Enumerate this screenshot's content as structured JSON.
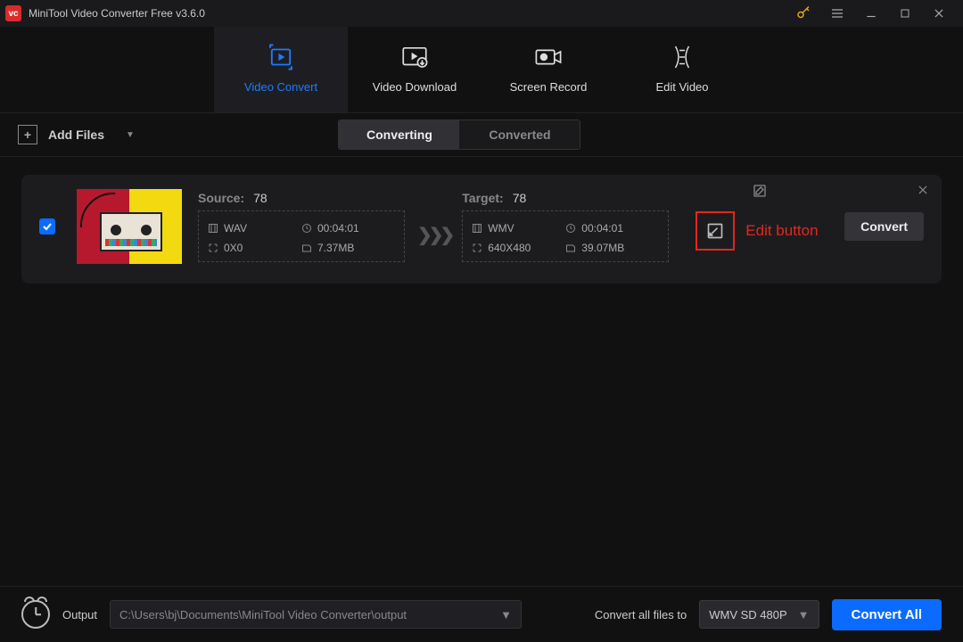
{
  "title": "MiniTool Video Converter Free v3.6.0",
  "nav": {
    "convert": "Video Convert",
    "download": "Video Download",
    "record": "Screen Record",
    "edit": "Edit Video"
  },
  "actionbar": {
    "add_files": "Add Files",
    "seg_converting": "Converting",
    "seg_converted": "Converted"
  },
  "item": {
    "source_label": "Source:",
    "source_name": "78",
    "source": {
      "fmt": "WAV",
      "duration": "00:04:01",
      "res": "0X0",
      "size": "7.37MB"
    },
    "target_label": "Target:",
    "target_name": "78",
    "target": {
      "fmt": "WMV",
      "duration": "00:04:01",
      "res": "640X480",
      "size": "39.07MB"
    },
    "convert_label": "Convert",
    "annotation": "Edit button"
  },
  "footer": {
    "output_label": "Output",
    "output_path": "C:\\Users\\bj\\Documents\\MiniTool Video Converter\\output",
    "convert_all_to_label": "Convert all files to",
    "format_selected": "WMV SD 480P",
    "convert_all_label": "Convert All"
  }
}
